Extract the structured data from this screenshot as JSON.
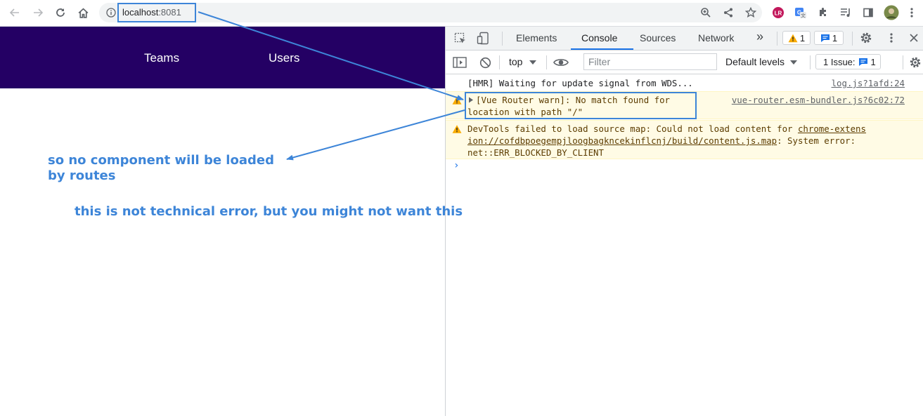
{
  "browser": {
    "url_host": "localhost",
    "url_port": ":8081",
    "back_icon": "arrow-left-icon",
    "forward_icon": "arrow-right-icon",
    "reload_icon": "reload-icon",
    "home_icon": "home-icon"
  },
  "app": {
    "nav_bg": "#240064",
    "nav_items": [
      "Teams",
      "Users"
    ]
  },
  "devtools": {
    "tabs": [
      "Elements",
      "Console",
      "Sources",
      "Network"
    ],
    "active_tab": "Console",
    "more_tabs": "»",
    "warnings_count": "1",
    "messages_count": "1",
    "context": "top",
    "filter_placeholder": "Filter",
    "levels": "Default levels",
    "issues_label": "1 Issue:",
    "issues_count": "1"
  },
  "console": {
    "messages": [
      {
        "type": "log",
        "lines": [
          "[HMR] Waiting for update signal from WDS..."
        ],
        "source": "log.js?1afd:24"
      },
      {
        "type": "warning",
        "lines": [
          "[Vue Router warn]: No match found for",
          "location with path \"/\""
        ],
        "source": "vue-router.esm-bundler.js?6c02:72"
      },
      {
        "type": "warning",
        "line1_text": "DevTools failed to load source map: Could not load content for ",
        "line1_link": "chrome-extens",
        "line2_link": "ion://cofdbpoegempjloogbagkncekinflcnj/build/content.js.map",
        "line2_text": ": System error:",
        "line3_text": "net::ERR_BLOCKED_BY_CLIENT"
      }
    ],
    "prompt": "›"
  },
  "annotations": {
    "note1_line1": "so no component will be loaded",
    "note1_line2": "by routes",
    "note2": "this is not technical error, but you might not want this",
    "color": "#3d85d8"
  }
}
